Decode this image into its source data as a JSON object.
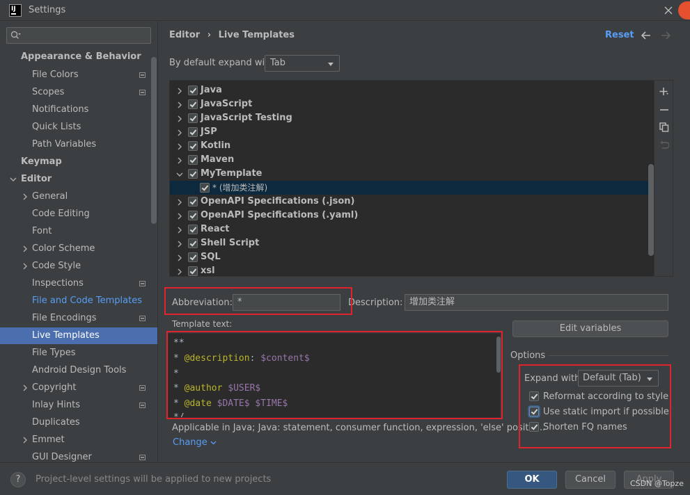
{
  "window": {
    "title": "Settings",
    "app_icon_text": "IJ"
  },
  "sidebar": {
    "search_placeholder": "",
    "items": [
      {
        "label": "Appearance & Behavior"
      },
      {
        "label": "File Colors"
      },
      {
        "label": "Scopes"
      },
      {
        "label": "Notifications"
      },
      {
        "label": "Quick Lists"
      },
      {
        "label": "Path Variables"
      },
      {
        "label": "Keymap"
      },
      {
        "label": "Editor"
      },
      {
        "label": "General"
      },
      {
        "label": "Code Editing"
      },
      {
        "label": "Font"
      },
      {
        "label": "Color Scheme"
      },
      {
        "label": "Code Style"
      },
      {
        "label": "Inspections"
      },
      {
        "label": "File and Code Templates"
      },
      {
        "label": "File Encodings"
      },
      {
        "label": "Live Templates"
      },
      {
        "label": "File Types"
      },
      {
        "label": "Android Design Tools"
      },
      {
        "label": "Copyright"
      },
      {
        "label": "Inlay Hints"
      },
      {
        "label": "Duplicates"
      },
      {
        "label": "Emmet"
      },
      {
        "label": "GUI Designer"
      }
    ]
  },
  "header": {
    "breadcrumb_parent": "Editor",
    "breadcrumb_sep": "›",
    "breadcrumb_current": "Live Templates",
    "reset_label": "Reset"
  },
  "expand_default": {
    "label": "By default expand with",
    "value": "Tab"
  },
  "template_groups": [
    {
      "label": "Java",
      "checked": true,
      "expanded": false
    },
    {
      "label": "JavaScript",
      "checked": true,
      "expanded": false
    },
    {
      "label": "JavaScript Testing",
      "checked": true,
      "expanded": false
    },
    {
      "label": "JSP",
      "checked": true,
      "expanded": false
    },
    {
      "label": "Kotlin",
      "checked": true,
      "expanded": false
    },
    {
      "label": "Maven",
      "checked": true,
      "expanded": false
    },
    {
      "label": "MyTemplate",
      "checked": true,
      "expanded": true
    },
    {
      "label": "* (增加类注解)",
      "checked": true,
      "child": true,
      "selected": true
    },
    {
      "label": "OpenAPI Specifications (.json)",
      "checked": true,
      "expanded": false
    },
    {
      "label": "OpenAPI Specifications (.yaml)",
      "checked": true,
      "expanded": false
    },
    {
      "label": "React",
      "checked": true,
      "expanded": false
    },
    {
      "label": "Shell Script",
      "checked": true,
      "expanded": false
    },
    {
      "label": "SQL",
      "checked": true,
      "expanded": false
    },
    {
      "label": "xsl",
      "checked": true,
      "expanded": false
    }
  ],
  "abbreviation": {
    "label": "Abbreviation:",
    "value": "*"
  },
  "description": {
    "label": "Description:",
    "value": "增加类注解"
  },
  "template_text": {
    "label": "Template text:",
    "lines": [
      "**",
      "* @description: $content$",
      "*",
      "* @author $USER$",
      "* @date $DATE$ $TIME$",
      "*/"
    ]
  },
  "edit_variables_label": "Edit variables",
  "applicable": "Applicable in Java; Java: statement, consumer function, expression, 'else' positio...",
  "change_label": "Change",
  "options": {
    "title": "Options",
    "expand_with_label": "Expand with",
    "expand_with_value": "Default (Tab)",
    "reformat_label": "Reformat according to style",
    "static_import_label": "Use static import if possible",
    "shorten_fq_label": "Shorten FQ names",
    "reformat_checked": true,
    "static_import_checked": true,
    "shorten_fq_checked": true
  },
  "footer": {
    "help_label": "?",
    "note": "Project-level settings will be applied to new projects",
    "ok_label": "OK",
    "cancel_label": "Cancel",
    "apply_label": "Apply",
    "watermark": "CSDN @Topze"
  },
  "colors": {
    "selection": "#4b6eaf",
    "link": "#589df6",
    "highlight_box": "#e0232c",
    "primary_button": "#365880"
  }
}
